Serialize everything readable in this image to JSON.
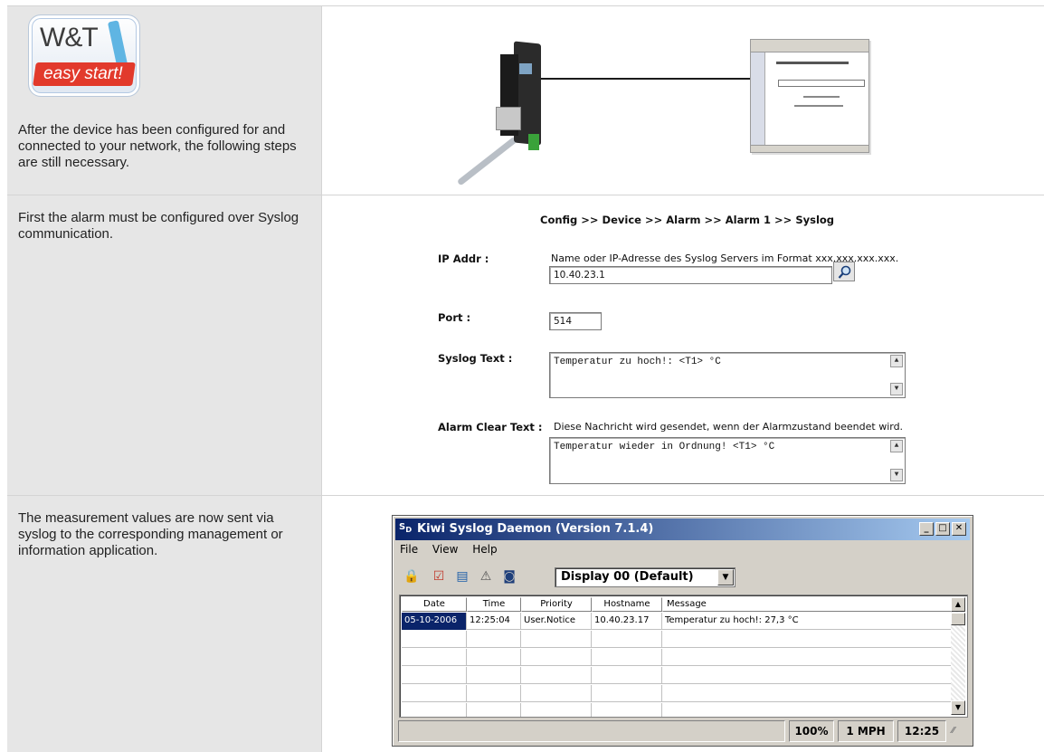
{
  "steps": [
    {
      "text": "After the device has been configured for and connected to your network, the following steps are still necessary."
    },
    {
      "text": "First the alarm must be configured over Syslog communication."
    },
    {
      "text": "The measurement values are now sent via syslog to the corresponding management or information application."
    }
  ],
  "logo": {
    "brand": "W&T",
    "tagline": "easy start!"
  },
  "config": {
    "breadcrumb": "Config >> Device >> Alarm >> Alarm 1 >> Syslog",
    "ip_label": "IP Addr :",
    "ip_desc": "Name oder IP-Adresse des Syslog Servers im Format xxx.xxx.xxx.xxx.",
    "ip_value": "10.40.23.1",
    "port_label": "Port :",
    "port_value": "514",
    "syslog_label": "Syslog Text :",
    "syslog_value": "Temperatur zu hoch!: <T1> °C",
    "clear_label": "Alarm Clear Text :",
    "clear_desc": "Diese Nachricht wird gesendet, wenn der Alarmzustand beendet wird.",
    "clear_value": "Temperatur wieder in Ordnung! <T1> °C",
    "lookup_icon": "magnifier-icon"
  },
  "kiwi": {
    "title": "Kiwi Syslog Daemon (Version 7.1.4)",
    "menu": [
      "File",
      "View",
      "Help"
    ],
    "display_select": "Display 00 (Default)",
    "columns": [
      "Date",
      "Time",
      "Priority",
      "Hostname",
      "Message"
    ],
    "rows": [
      {
        "date": "05-10-2006",
        "time": "12:25:04",
        "priority": "User.Notice",
        "hostname": "10.40.23.17",
        "message": "Temperatur zu hoch!: 27,3 °C"
      }
    ],
    "status": {
      "percent": "100%",
      "rate": "1 MPH",
      "time": "12:25"
    }
  }
}
